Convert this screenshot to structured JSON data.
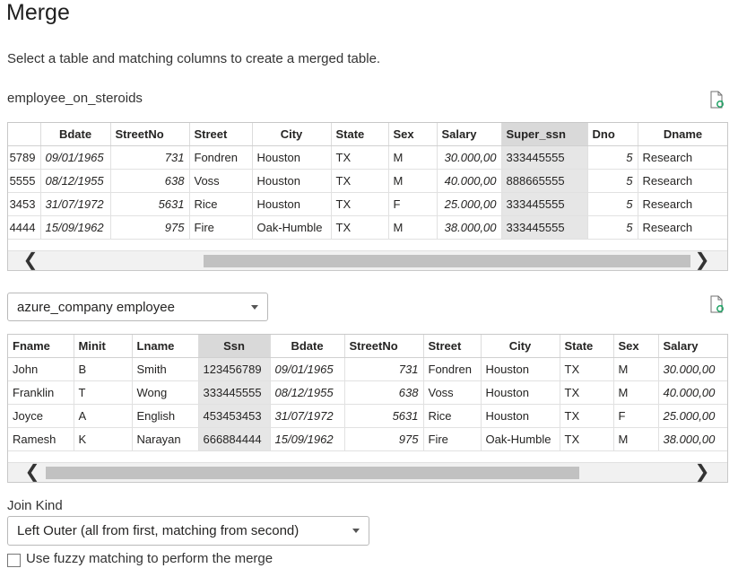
{
  "title": "Merge",
  "subtitle": "Select a table and matching columns to create a merged table.",
  "table1": {
    "name": "employee_on_steroids",
    "columns": [
      "",
      "Bdate",
      "StreetNo",
      "Street",
      "City",
      "State",
      "Sex",
      "Salary",
      "Super_ssn",
      "Dno",
      "Dname"
    ],
    "rows": [
      [
        "5789",
        "09/01/1965",
        "731",
        "Fondren",
        "Houston",
        "TX",
        "M",
        "30.000,00",
        "333445555",
        "5",
        "Research"
      ],
      [
        "5555",
        "08/12/1955",
        "638",
        "Voss",
        "Houston",
        "TX",
        "M",
        "40.000,00",
        "888665555",
        "5",
        "Research"
      ],
      [
        "3453",
        "31/07/1972",
        "5631",
        "Rice",
        "Houston",
        "TX",
        "F",
        "25.000,00",
        "333445555",
        "5",
        "Research"
      ],
      [
        "4444",
        "15/09/1962",
        "975",
        "Fire",
        "Oak-Humble",
        "TX",
        "M",
        "38.000,00",
        "333445555",
        "5",
        "Research"
      ]
    ],
    "selected_column": "Super_ssn"
  },
  "table2": {
    "name": "azure_company employee",
    "columns": [
      "Fname",
      "Minit",
      "Lname",
      "Ssn",
      "Bdate",
      "StreetNo",
      "Street",
      "City",
      "State",
      "Sex",
      "Salary"
    ],
    "rows": [
      [
        "John",
        "B",
        "Smith",
        "123456789",
        "09/01/1965",
        "731",
        "Fondren",
        "Houston",
        "TX",
        "M",
        "30.000,00"
      ],
      [
        "Franklin",
        "T",
        "Wong",
        "333445555",
        "08/12/1955",
        "638",
        "Voss",
        "Houston",
        "TX",
        "M",
        "40.000,00"
      ],
      [
        "Joyce",
        "A",
        "English",
        "453453453",
        "31/07/1972",
        "5631",
        "Rice",
        "Houston",
        "TX",
        "F",
        "25.000,00"
      ],
      [
        "Ramesh",
        "K",
        "Narayan",
        "666884444",
        "15/09/1962",
        "975",
        "Fire",
        "Oak-Humble",
        "TX",
        "M",
        "38.000,00"
      ]
    ],
    "selected_column": "Ssn"
  },
  "join_kind": {
    "label": "Join Kind",
    "value": "Left Outer (all from first, matching from second)"
  },
  "fuzzy": {
    "label": "Use fuzzy matching to perform the merge",
    "checked": false
  },
  "scroll_left": "❮",
  "scroll_right": "❯",
  "accent_color": "#21a366"
}
